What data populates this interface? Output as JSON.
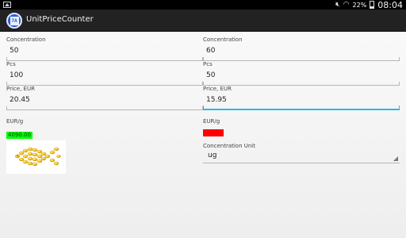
{
  "status_bar": {
    "battery": "22%",
    "time": "08:04",
    "icons": [
      "picture-icon",
      "mute-icon",
      "wifi-icon",
      "battery-icon"
    ]
  },
  "action_bar": {
    "title": "UnitPriceCounter",
    "app_icon_text": "7A"
  },
  "left": {
    "concentration_label": "Concentration",
    "concentration_value": "50",
    "pcs_label": "Pcs",
    "pcs_value": "100",
    "price_label": "Price, EUR",
    "price_value": "20.45",
    "result_label": "EUR/g",
    "result_value": "4090.00",
    "result_color": "#00ff00"
  },
  "right": {
    "concentration_label": "Concentration",
    "concentration_value": "60",
    "pcs_label": "Pcs",
    "pcs_value": "50",
    "price_label": "Price, EUR",
    "price_value": "15.95",
    "result_label": "EUR/g",
    "result_value": "",
    "result_color": "#ff0000",
    "unit_label": "Concentration Unit",
    "unit_value": "ug"
  },
  "colors": {
    "focus_accent": "#33b5e5",
    "action_bar": "#222222"
  }
}
